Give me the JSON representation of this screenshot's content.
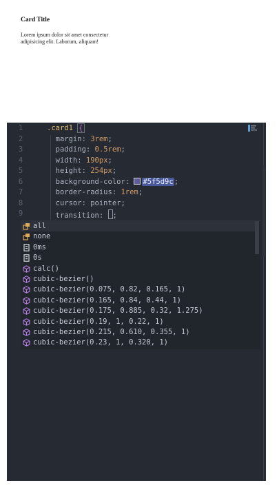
{
  "preview": {
    "card_title": "Card Title",
    "card_body": "Lorem ipsum dolor sit amet consectetur adipisicing elit. Laborum, aliquam!"
  },
  "editor": {
    "lines": [
      {
        "n": "1",
        "parts": [
          {
            "cls": "sel",
            "t": ".card1 "
          },
          {
            "cls": "brace",
            "t": "{"
          }
        ]
      },
      {
        "n": "2",
        "parts": [
          {
            "cls": "prop",
            "t": "  margin: "
          },
          {
            "cls": "num",
            "t": "3rem"
          },
          {
            "cls": "punct",
            "t": ";"
          }
        ]
      },
      {
        "n": "3",
        "parts": [
          {
            "cls": "prop",
            "t": "  padding: "
          },
          {
            "cls": "num",
            "t": "0.5rem"
          },
          {
            "cls": "punct",
            "t": ";"
          }
        ]
      },
      {
        "n": "4",
        "parts": [
          {
            "cls": "prop",
            "t": "  width: "
          },
          {
            "cls": "num",
            "t": "190px"
          },
          {
            "cls": "punct",
            "t": ";"
          }
        ]
      },
      {
        "n": "5",
        "parts": [
          {
            "cls": "prop",
            "t": "  height: "
          },
          {
            "cls": "num",
            "t": "254px"
          },
          {
            "cls": "punct",
            "t": ";"
          }
        ]
      },
      {
        "n": "6",
        "parts": [
          {
            "cls": "prop",
            "t": "  background-color: "
          },
          {
            "cls": "chip",
            "t": ""
          },
          {
            "cls": "hex-hl",
            "t": "#5f5d9c"
          },
          {
            "cls": "punct",
            "t": ";"
          }
        ]
      },
      {
        "n": "7",
        "parts": [
          {
            "cls": "prop",
            "t": "  border-radius: "
          },
          {
            "cls": "num",
            "t": "1rem"
          },
          {
            "cls": "punct",
            "t": ";"
          }
        ]
      },
      {
        "n": "8",
        "parts": [
          {
            "cls": "prop",
            "t": "  cursor: pointer;"
          }
        ]
      },
      {
        "n": "9",
        "parts": [
          {
            "cls": "prop",
            "t": "  transition: "
          },
          {
            "cls": "cursor",
            "t": ""
          },
          {
            "cls": "punct",
            "t": ";"
          }
        ]
      }
    ],
    "swatch_color": "#5f5d9c"
  },
  "suggestions": [
    {
      "icon": "keyword-icon",
      "label": "all",
      "selected": true
    },
    {
      "icon": "keyword-icon",
      "label": "none",
      "selected": false
    },
    {
      "icon": "unit-icon",
      "label": "0ms",
      "selected": false
    },
    {
      "icon": "unit-icon",
      "label": "0s",
      "selected": false
    },
    {
      "icon": "function-icon",
      "label": "calc()",
      "selected": false
    },
    {
      "icon": "function-icon",
      "label": "cubic-bezier()",
      "selected": false
    },
    {
      "icon": "function-icon",
      "label": "cubic-bezier(0.075, 0.82, 0.165, 1)",
      "selected": false
    },
    {
      "icon": "function-icon",
      "label": "cubic-bezier(0.165, 0.84, 0.44, 1)",
      "selected": false
    },
    {
      "icon": "function-icon",
      "label": "cubic-bezier(0.175, 0.885, 0.32, 1.275)",
      "selected": false
    },
    {
      "icon": "function-icon",
      "label": "cubic-bezier(0.19, 1, 0.22, 1)",
      "selected": false
    },
    {
      "icon": "function-icon",
      "label": "cubic-bezier(0.215, 0.610, 0.355, 1)",
      "selected": false
    },
    {
      "icon": "function-icon",
      "label": "cubic-bezier(0.23, 1, 0.320, 1)",
      "selected": false
    }
  ],
  "colors": {
    "editor_bg": "#262b33",
    "keyword_icon": "#e0a95a",
    "function_icon": "#b57fe0",
    "unit_icon": "#d7dae0"
  }
}
